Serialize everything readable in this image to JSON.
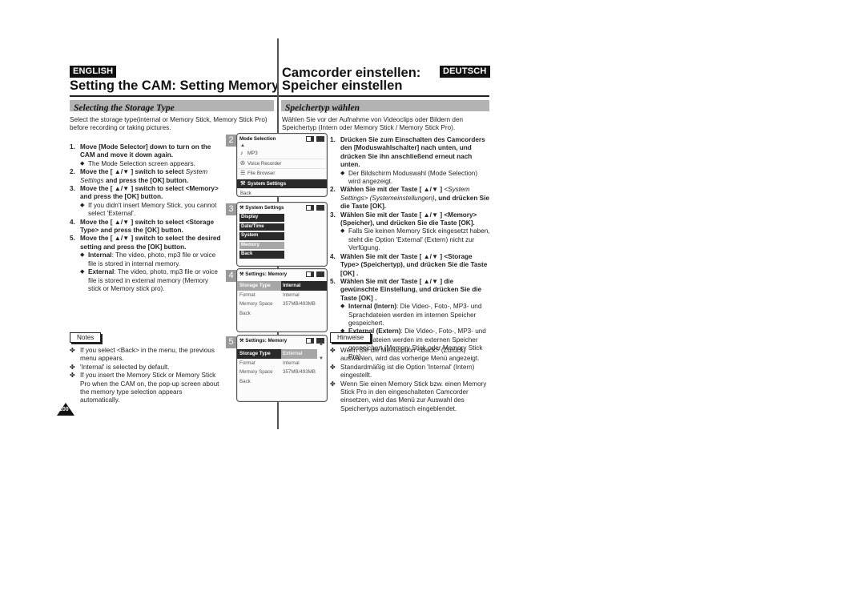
{
  "header": {
    "lang_left": "ENGLISH",
    "lang_right": "DEUTSCH",
    "title_en": "Setting the CAM: Setting Memory",
    "title_de_line1": "Camcorder einstellen:",
    "title_de_line2": "Speicher einstellen"
  },
  "en": {
    "section_title": "Selecting the Storage Type",
    "intro": "Select the storage type(internal or Memory Stick, Memory Stick Pro) before recording or taking pictures.",
    "steps": [
      {
        "num": "1.",
        "text": "Move [Mode Selector] down to turn on the CAM and move it down again."
      },
      {
        "num": "2.",
        "text_a": "Move the [ ▲/▼ ] switch to select ",
        "text_it": "System Settings",
        "text_b": " and press the [OK] button."
      },
      {
        "num": "3.",
        "text": "Move the [ ▲/▼ ] switch to select <Memory> and press the [OK] button."
      },
      {
        "num": "4.",
        "text": "Move the [ ▲/▼ ] switch to select <Storage Type> and press the [OK] button."
      },
      {
        "num": "5.",
        "text": "Move the [ ▲/▼ ] switch to select the desired setting and press the [OK] button."
      }
    ],
    "bullet_1": "The Mode Selection screen appears.",
    "bullet_3": "If you didn't insert Memory Stick, you cannot select 'External'.",
    "internal_label": "Internal",
    "internal_text": ": The video, photo, mp3 file or voice file is stored in internal memory.",
    "external_label": "External",
    "external_text": ": The video, photo, mp3 file or voice file is stored in external memory (Memory stick or Memory stick pro).",
    "notes_label": "Notes",
    "notes": [
      "If you select <Back> in the menu, the previous menu appears.",
      "'Internal' is selected by default.",
      "If you insert the Memory Stick or Memory Stick Pro when the CAM on, the pop-up screen about the memory type selection appears automatically."
    ],
    "page_number": "100"
  },
  "de": {
    "section_title": "Speichertyp wählen",
    "intro": "Wählen Sie vor der Aufnahme von Videoclips oder Bildern den Speichertyp (Intern oder Memory Stick / Memory Stick Pro).",
    "step1": "Drücken Sie zum Einschalten des Camcorders den [Moduswahlschalter] nach unten, und drücken Sie ihn anschließend erneut nach unten.",
    "bullet_1": "Der Bildschirm Moduswahl (Mode Selection) wird angezeigt.",
    "step2_a": "Wählen Sie mit der Taste [ ▲/▼ ] ",
    "step2_it": "<System Settings> (Systemeinstellungen)",
    "step2_b": ", und drücken Sie die Taste [OK].",
    "step3": "Wählen Sie mit der Taste [ ▲/▼ ] <Memory> (Speicher), und drücken Sie die  Taste [OK].",
    "bullet_3": "Falls Sie keinen Memory Stick eingesetzt haben, steht die Option 'External' (Extern) nicht zur Verfügung.",
    "step4": "Wählen Sie mit der Taste [ ▲/▼ ] <Storage Type> (Speichertyp), und drücken Sie die Taste [OK] .",
    "step5": "Wählen Sie mit der Taste [ ▲/▼ ] die gewünschte Einstellung, und drücken Sie die Taste [OK] .",
    "internal_label": "Internal (Intern)",
    "internal_text": ": Die Video-, Foto-, MP3- und Sprachdateien werden im internen Speicher gespeichert.",
    "external_label": "External (Extern)",
    "external_text": ": Die Video-, Foto-, MP3- und Sprachdateien werden im externen Speicher gespeichert (Memory Stick oder Memory Stick Pro).",
    "notes_label": "Hinweise",
    "notes": [
      "Wenn Sie die Menüoption <Back> (Zurück) auswählen, wird das vorherige Menü angezeigt.",
      "Standardmäßig ist die Option 'Internal' (Intern) eingestellt.",
      "Wenn Sie einen Memory Stick bzw. einen Memory Stick Pro in den eingeschalteten Camcorder einsetzen, wird das Menü zur Auswahl des Speichertyps automatisch eingeblendet."
    ]
  },
  "screens": {
    "s2": {
      "num": "2",
      "title": "Mode Selection",
      "items": [
        {
          "icon": "music-note-icon",
          "glyph": "♪",
          "label": "MP3"
        },
        {
          "icon": "microphone-icon",
          "glyph": "↓",
          "label": "Voice Recorder"
        },
        {
          "icon": "file-browser-icon",
          "glyph": "☰",
          "label": "File Browser"
        },
        {
          "icon": "settings-icon",
          "glyph": "↕",
          "label": "System Settings",
          "selected": true
        },
        {
          "icon": "",
          "glyph": "",
          "label": "Back"
        }
      ]
    },
    "s3": {
      "num": "3",
      "title": "System Settings",
      "items": [
        "Display",
        "Date/Time",
        "System",
        "Memory",
        "Back"
      ],
      "highlighted": "Memory"
    },
    "s4": {
      "num": "4",
      "title": "Settings: Memory",
      "rows": [
        {
          "key": "Storage Type",
          "value": "Internal"
        },
        {
          "key": "Format",
          "value": "Internal"
        },
        {
          "key": "Memory Space",
          "value": "357MB/493MB"
        },
        {
          "key": "Back",
          "value": ""
        }
      ]
    },
    "s5": {
      "num": "5",
      "title": "Settings: Memory",
      "rows": [
        {
          "key": "Storage Type",
          "value": "External"
        },
        {
          "key": "Format",
          "value": "Internal"
        },
        {
          "key": "Memory Space",
          "value": "357MB/493MB"
        },
        {
          "key": "Back",
          "value": ""
        }
      ]
    }
  }
}
